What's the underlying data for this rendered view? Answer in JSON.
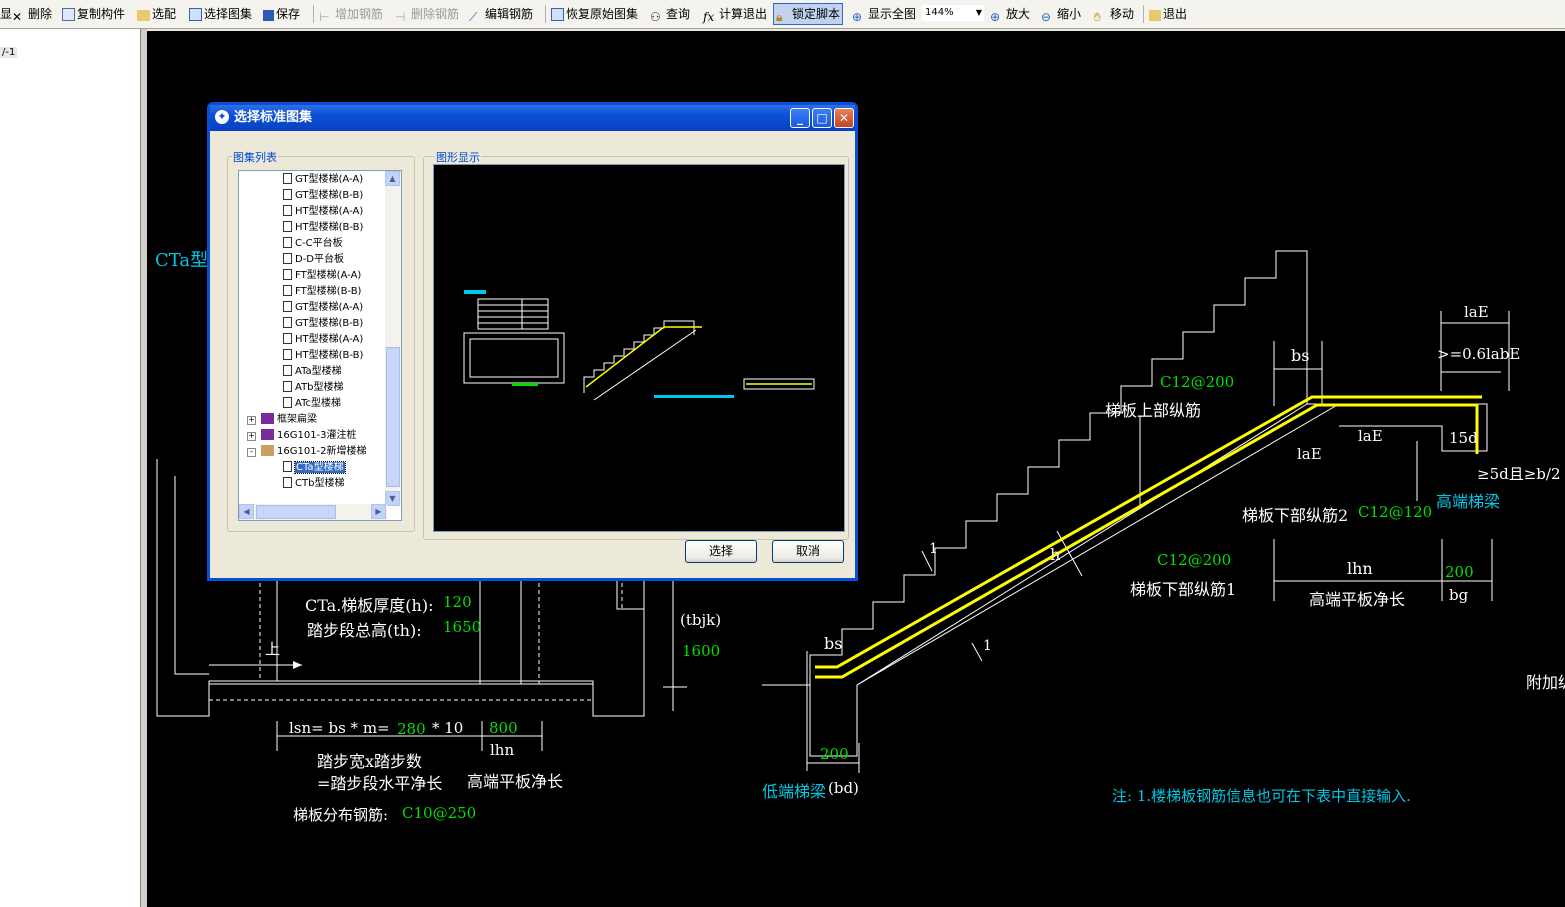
{
  "toolbar": {
    "items": [
      {
        "name": "partial-left-button",
        "label": "显"
      },
      {
        "name": "delete-button",
        "label": "删除"
      },
      {
        "name": "copy-component-button",
        "label": "复制构件"
      },
      {
        "name": "select-fit-button",
        "label": "选配"
      },
      {
        "name": "select-atlas-button",
        "label": "选择图集"
      },
      {
        "name": "save-button",
        "label": "保存"
      },
      {
        "name": "add-rebar-button",
        "label": "增加钢筋"
      },
      {
        "name": "delete-rebar-button",
        "label": "删除钢筋"
      },
      {
        "name": "edit-rebar-button",
        "label": "编辑钢筋"
      },
      {
        "name": "restore-original-button",
        "label": "恢复原始图集"
      },
      {
        "name": "query-button",
        "label": "查询"
      },
      {
        "name": "calc-exit-button",
        "label": "计算退出"
      },
      {
        "name": "lock-script-button",
        "label": "锁定脚本"
      },
      {
        "name": "show-all-button",
        "label": "显示全图"
      },
      {
        "name": "zoom-in-button",
        "label": "放大"
      },
      {
        "name": "zoom-out-button",
        "label": "缩小"
      },
      {
        "name": "move-button",
        "label": "移动"
      },
      {
        "name": "exit-button",
        "label": "退出"
      }
    ],
    "zoom_value": "144%"
  },
  "left_panel": {
    "item": "/-1"
  },
  "canvas": {
    "labels": {
      "cta_type": "CTa型",
      "slab_thickness": "CTa.梯板厚度(h):",
      "slab_thickness_val": "120",
      "step_height": "踏步段总高(th):",
      "step_height_val": "1650",
      "tbjk": "(tbjk)",
      "tbjk_val": "1600",
      "up": "上",
      "lsn": "lsn= bs * m=",
      "lsn_bs": "280",
      "lsn_m": "* 10",
      "lhn_val": "800",
      "lhn": "lhn",
      "step_desc1": "踏步宽x踏步数",
      "step_desc2": "=踏步段水平净长",
      "high_platform_len": "高端平板净长",
      "dist_rebar": "梯板分布钢筋:",
      "dist_rebar_val": "C10@250",
      "lae_top": "laE",
      "lab_e": ">=0.6labE",
      "bs_top": "bs",
      "c12_200_top": "C12@200",
      "upper_rebar": "梯板上部纵筋",
      "lae_mid": "laE",
      "lae_mid2": "laE",
      "d15": "15d",
      "d5": "≥5d且≥b/2",
      "high_beam": "高端梯梁",
      "lower_rebar2": "梯板下部纵筋2",
      "lower_rebar2_val": "C12@120",
      "h_label": "h",
      "c12_200_low": "C12@200",
      "lower_rebar1": "梯板下部纵筋1",
      "lhn2": "lhn",
      "high_platform_len2": "高端平板净长",
      "v200": "200",
      "bg": "bg",
      "bs_low": "bs",
      "one_a": "1",
      "one_b": "1",
      "v200_low": "200",
      "low_beam": "低端梯梁",
      "bd": "(bd)",
      "extra": "附加纵",
      "note": "注: 1.楼梯板钢筋信息也可在下表中直接输入."
    }
  },
  "dialog": {
    "title": "选择标准图集",
    "list_group": "图集列表",
    "preview_group": "图形显示",
    "tree": [
      {
        "label": "GT型楼梯(A-A)",
        "kind": "doc",
        "indent": 2
      },
      {
        "label": "GT型楼梯(B-B)",
        "kind": "doc",
        "indent": 2
      },
      {
        "label": "HT型楼梯(A-A)",
        "kind": "doc",
        "indent": 2
      },
      {
        "label": "HT型楼梯(B-B)",
        "kind": "doc",
        "indent": 2
      },
      {
        "label": "C-C平台板",
        "kind": "doc",
        "indent": 2
      },
      {
        "label": "D-D平台板",
        "kind": "doc",
        "indent": 2
      },
      {
        "label": "FT型楼梯(A-A)",
        "kind": "doc",
        "indent": 2
      },
      {
        "label": "FT型楼梯(B-B)",
        "kind": "doc",
        "indent": 2
      },
      {
        "label": "GT型楼梯(A-A)",
        "kind": "doc",
        "indent": 2
      },
      {
        "label": "GT型楼梯(B-B)",
        "kind": "doc",
        "indent": 2
      },
      {
        "label": "HT型楼梯(A-A)",
        "kind": "doc",
        "indent": 2
      },
      {
        "label": "HT型楼梯(B-B)",
        "kind": "doc",
        "indent": 2
      },
      {
        "label": "ATa型楼梯",
        "kind": "doc",
        "indent": 2
      },
      {
        "label": "ATb型楼梯",
        "kind": "doc",
        "indent": 2
      },
      {
        "label": "ATc型楼梯",
        "kind": "doc",
        "indent": 2
      },
      {
        "label": "框架扁梁",
        "kind": "book",
        "indent": 1,
        "expander": "+"
      },
      {
        "label": "16G101-3灌注桩",
        "kind": "book",
        "indent": 1,
        "expander": "+"
      },
      {
        "label": "16G101-2新增楼梯",
        "kind": "book-open",
        "indent": 1,
        "expander": "-"
      },
      {
        "label": "CTa型楼梯",
        "kind": "doc",
        "indent": 2,
        "selected": true
      },
      {
        "label": "CTb型楼梯",
        "kind": "doc",
        "indent": 2
      }
    ],
    "select_button": "选择",
    "cancel_button": "取消",
    "window_buttons": {
      "minimize": "_",
      "maximize": "□",
      "close": "✕"
    }
  }
}
